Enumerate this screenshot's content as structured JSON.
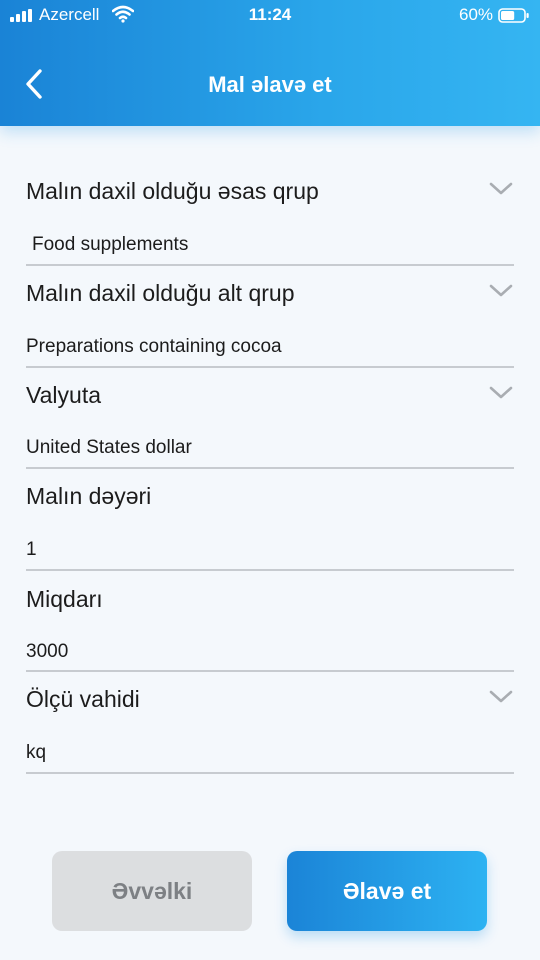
{
  "status_bar": {
    "carrier": "Azercell",
    "time": "11:24",
    "battery": "60%",
    "battery_level": 0.6
  },
  "header": {
    "title": "Mal əlavə et",
    "back_icon": "chevron-left-icon"
  },
  "form": {
    "fields": [
      {
        "label": "Malın daxil olduğu əsas qrup",
        "value": "Food supplements",
        "type": "select"
      },
      {
        "label": "Malın daxil olduğu alt qrup",
        "value": "Preparations containing cocoa",
        "type": "select"
      },
      {
        "label": "Valyuta",
        "value": "United States dollar",
        "type": "select"
      },
      {
        "label": "Malın dəyəri",
        "value": "1",
        "type": "input"
      },
      {
        "label": "Miqdarı",
        "value": "3000",
        "type": "input"
      },
      {
        "label": "Ölçü vahidi",
        "value": "kq",
        "type": "select"
      }
    ]
  },
  "buttons": {
    "previous": "Əvvəlki",
    "add": "Əlavə et"
  },
  "colors": {
    "accent": "#2aa6ea",
    "background": "#f4f8fc",
    "disabled_button": "#dcdee0"
  }
}
